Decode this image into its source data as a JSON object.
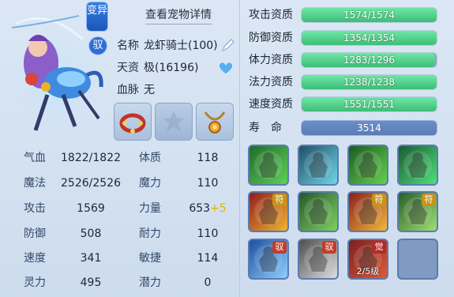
{
  "header": {
    "badge_top": "变异",
    "badge_mount": "驭",
    "detail_link": "查看宠物详情"
  },
  "pet": {
    "name_label": "名称",
    "name_value": "龙虾骑士(100)",
    "aptitude_label": "天资",
    "aptitude_value": "极(16196)",
    "bloodline_label": "血脉",
    "bloodline_value": "无"
  },
  "equipment": [
    {
      "name": "collar-item-icon"
    },
    {
      "name": "empty-slot-icon"
    },
    {
      "name": "necklace-item-icon"
    }
  ],
  "attributes_left": [
    {
      "label": "气血",
      "value": "1822/1822"
    },
    {
      "label": "魔法",
      "value": "2526/2526"
    },
    {
      "label": "攻击",
      "value": "1569"
    },
    {
      "label": "防御",
      "value": "508"
    },
    {
      "label": "速度",
      "value": "341"
    },
    {
      "label": "灵力",
      "value": "495"
    }
  ],
  "attributes_right": [
    {
      "label": "体质",
      "value": "118",
      "bonus": ""
    },
    {
      "label": "魔力",
      "value": "110",
      "bonus": ""
    },
    {
      "label": "力量",
      "value": "653",
      "bonus": "+5"
    },
    {
      "label": "耐力",
      "value": "110",
      "bonus": ""
    },
    {
      "label": "敏捷",
      "value": "114",
      "bonus": ""
    },
    {
      "label": "潜力",
      "value": "0",
      "bonus": ""
    }
  ],
  "aptitudes": [
    {
      "label": "攻击资质",
      "text": "1574/1574",
      "fill": 1.0
    },
    {
      "label": "防御资质",
      "text": "1354/1354",
      "fill": 1.0
    },
    {
      "label": "体力资质",
      "text": "1283/1296",
      "fill": 0.99
    },
    {
      "label": "法力资质",
      "text": "1238/1238",
      "fill": 1.0
    },
    {
      "label": "速度资质",
      "text": "1551/1551",
      "fill": 1.0
    }
  ],
  "life": {
    "label": "寿　命",
    "value": "3514"
  },
  "skills": [
    {
      "name": "skill-green-warrior-icon",
      "tag": "",
      "level": ""
    },
    {
      "name": "skill-teal-figure-icon",
      "tag": "",
      "level": ""
    },
    {
      "name": "skill-green-sword-icon",
      "tag": "",
      "level": ""
    },
    {
      "name": "skill-green-claw-icon",
      "tag": "",
      "level": ""
    },
    {
      "name": "skill-talisman-red-icon",
      "tag": "符",
      "level": ""
    },
    {
      "name": "skill-green-brute-icon",
      "tag": "",
      "level": ""
    },
    {
      "name": "skill-talisman-gold-icon",
      "tag": "符",
      "level": ""
    },
    {
      "name": "skill-green-runner-icon",
      "tag": "符",
      "level": ""
    },
    {
      "name": "skill-shield-icon",
      "tag": "驭",
      "level": ""
    },
    {
      "name": "skill-cup-icon",
      "tag": "驭",
      "level": ""
    },
    {
      "name": "skill-awaken-icon",
      "tag": "觉",
      "level": "2/5级"
    },
    {
      "name": "skill-empty-slot",
      "tag": "",
      "level": ""
    }
  ],
  "colors": {
    "apt_fill": "#46c985",
    "life_bar": "#5a7db7",
    "bonus": "#e6b400"
  }
}
